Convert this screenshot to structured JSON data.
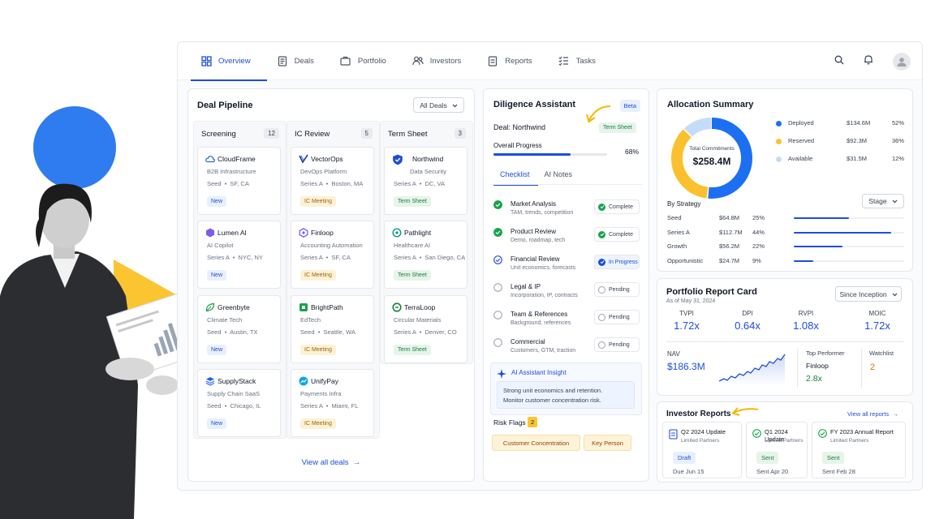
{
  "nav": {
    "tabs": [
      {
        "label": "Overview",
        "icon": "grid-icon"
      },
      {
        "label": "Deals",
        "icon": "document-icon"
      },
      {
        "label": "Portfolio",
        "icon": "briefcase-icon"
      },
      {
        "label": "Investors",
        "icon": "people-icon"
      },
      {
        "label": "Reports",
        "icon": "report-icon"
      },
      {
        "label": "Tasks",
        "icon": "checklist-icon"
      }
    ],
    "active": "Overview"
  },
  "pipeline": {
    "title": "Deal Pipeline",
    "filter": "All Deals",
    "view_all": "View all deals",
    "columns": [
      {
        "name": "Screening",
        "count": "12",
        "cards": [
          {
            "name": "CloudFrame",
            "sub": "B2B Infrastructure",
            "stage": "Seed",
            "location": "SF, CA",
            "tag": "New"
          },
          {
            "name": "Lumen AI",
            "sub": "AI Copilot",
            "stage": "Series A",
            "location": "NYC, NY",
            "tag": "New"
          },
          {
            "name": "Greenbyte",
            "sub": "Climate Tech",
            "stage": "Seed",
            "location": "Austin, TX",
            "tag": "New"
          },
          {
            "name": "SupplyStack",
            "sub": "Supply Chain SaaS",
            "stage": "Seed",
            "location": "Chicago, IL",
            "tag": "New"
          }
        ]
      },
      {
        "name": "IC Review",
        "count": "5",
        "cards": [
          {
            "name": "VectorOps",
            "sub": "DevOps Platform",
            "stage": "Series A",
            "location": "Boston, MA",
            "tag": "IC Meeting"
          },
          {
            "name": "Finloop",
            "sub": "Accounting Automation",
            "stage": "Series A",
            "location": "SF, CA",
            "tag": "IC Meeting"
          },
          {
            "name": "BrightPath",
            "sub": "EdTech",
            "stage": "Seed",
            "location": "Seattle, WA",
            "tag": "IC Meeting"
          },
          {
            "name": "UnifyPay",
            "sub": "Payments Infra",
            "stage": "Series A",
            "location": "Miami, FL",
            "tag": "IC Meeting"
          }
        ]
      },
      {
        "name": "Term Sheet",
        "count": "3",
        "cards": [
          {
            "name": "Northwind",
            "sub": "Data Security",
            "stage": "Series A",
            "location": "DC, VA",
            "tag": "Term Sheet"
          },
          {
            "name": "Pathlight",
            "sub": "Healthcare AI",
            "stage": "Series A",
            "location": "San Diego, CA",
            "tag": "Term Sheet"
          },
          {
            "name": "TerraLoop",
            "sub": "Circular Materials",
            "stage": "Series A",
            "location": "Denver, CO",
            "tag": "Term Sheet"
          }
        ]
      }
    ]
  },
  "diligence": {
    "title": "Diligence Assistant",
    "badge": "Beta",
    "deal_label": "Deal: Northwind",
    "deal_stage": "Term Sheet",
    "progress_label": "Overall Progress",
    "progress_text": "68%",
    "progress_value": 68,
    "tabs": [
      "Checklist",
      "AI Notes"
    ],
    "items": [
      {
        "title": "Market Analysis",
        "sub": "TAM, trends, competition",
        "status": "Complete",
        "state": "done"
      },
      {
        "title": "Product Review",
        "sub": "Demo, roadmap, tech",
        "status": "Complete",
        "state": "done"
      },
      {
        "title": "Financial Review",
        "sub": "Unit economics, forecasts",
        "status": "In Progress",
        "state": "progress"
      },
      {
        "title": "Legal & IP",
        "sub": "Incorporation, IP, contracts",
        "status": "Pending",
        "state": "pending"
      },
      {
        "title": "Team & References",
        "sub": "Background, references",
        "status": "Pending",
        "state": "pending"
      },
      {
        "title": "Commercial",
        "sub": "Customers, GTM, traction",
        "status": "Pending",
        "state": "pending"
      }
    ],
    "insight_title": "AI Assistant Insight",
    "insight_line1": "Strong unit economics and retention.",
    "insight_line2": "Monitor customer concentration risk.",
    "risk_label": "Risk Flags",
    "risk_count": "2",
    "risks": [
      "Customer Concentration",
      "Key Person"
    ]
  },
  "allocation": {
    "title": "Allocation Summary",
    "center_label": "Total Commitments",
    "center_value": "$258.4M",
    "segments": [
      {
        "label": "Deployed",
        "amount": "$134.6M",
        "pct": "52%",
        "value": 52,
        "color": "#1d6ff2"
      },
      {
        "label": "Reserved",
        "amount": "$92.3M",
        "pct": "36%",
        "value": 36,
        "color": "#fbc02d"
      },
      {
        "label": "Available",
        "amount": "$31.5M",
        "pct": "12%",
        "value": 12,
        "color": "#c5dcf8"
      }
    ],
    "strategy_label": "By Strategy",
    "strategy_filter": "Stage",
    "strategies": [
      {
        "name": "Seed",
        "amount": "$64.8M",
        "pct": "25%",
        "value": 25
      },
      {
        "name": "Series A",
        "amount": "$112.7M",
        "pct": "44%",
        "value": 44
      },
      {
        "name": "Growth",
        "amount": "$56.2M",
        "pct": "22%",
        "value": 22
      },
      {
        "name": "Opportunistic",
        "amount": "$24.7M",
        "pct": "9%",
        "value": 9
      }
    ]
  },
  "report_card": {
    "title": "Portfolio Report Card",
    "as_of": "As of May 31, 2024",
    "filter": "Since Inception",
    "metrics": [
      {
        "label": "TVPI",
        "value": "1.72x"
      },
      {
        "label": "DPI",
        "value": "0.64x"
      },
      {
        "label": "RVPI",
        "value": "1.08x"
      },
      {
        "label": "MOIC",
        "value": "1.72x"
      }
    ],
    "nav_label": "NAV",
    "nav_value": "$186.3M",
    "top_label": "Top Performer",
    "top_name": "Finloop",
    "top_value": "2.8x",
    "watch_label": "Watchlist",
    "watch_value": "2"
  },
  "investor_reports": {
    "title": "Investor Reports",
    "view_all": "View all reports",
    "items": [
      {
        "title": "Q2 2024 Update",
        "sub": "Limited Partners",
        "status": "Draft",
        "date": "Due Jun 15"
      },
      {
        "title": "Q1 2024 Update",
        "sub": "Limited Partners",
        "status": "Sent",
        "date": "Sent Apr 20"
      },
      {
        "title": "FY 2023 Annual Report",
        "sub": "Limited Partners",
        "status": "Sent",
        "date": "Sent Feb 28"
      }
    ]
  },
  "colors": {
    "accent": "#1d4ed8",
    "yellow": "#fbc531",
    "blue_shape": "#2f7cf0"
  }
}
